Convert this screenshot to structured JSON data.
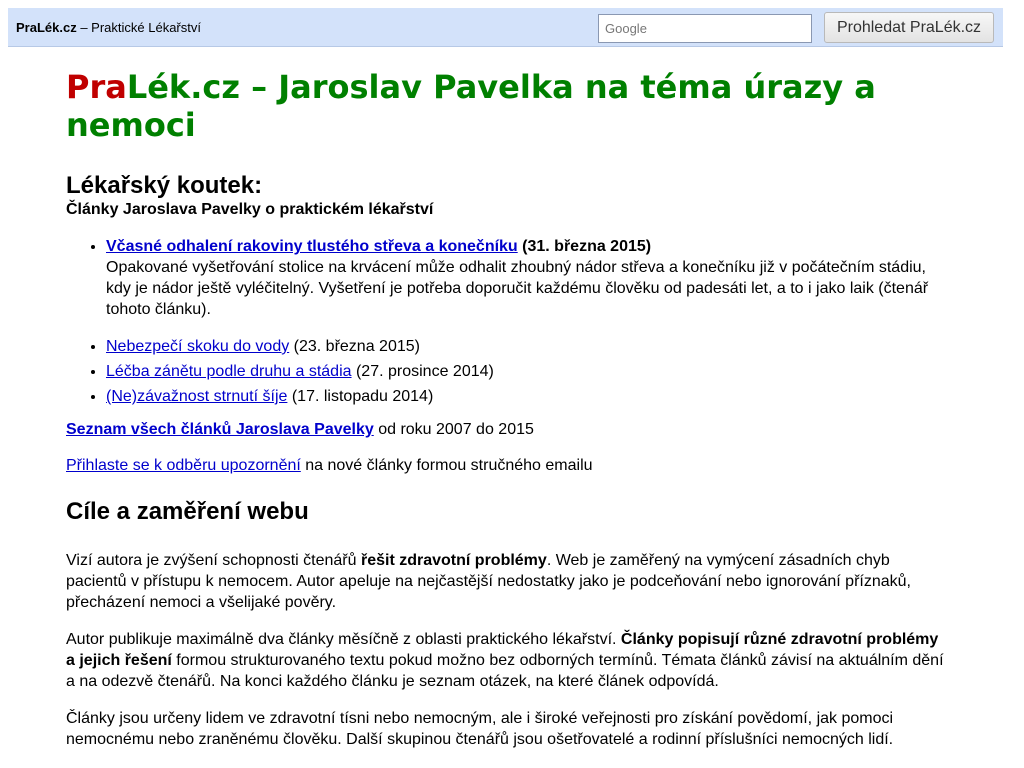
{
  "topbar": {
    "brand_name": "PraLék.cz",
    "brand_tagline": " – Praktické Lékařství",
    "search_placeholder": "Google",
    "search_button": "Prohledat PraLék.cz"
  },
  "header": {
    "title_pra": "Pra",
    "title_rest": "Lék.cz – Jaroslav Pavelka na téma úrazy a nemoci"
  },
  "koutek": {
    "title": "Lékařský koutek:",
    "subtitle": "Články Jaroslava Pavelky o praktickém lékařství"
  },
  "articles": [
    {
      "link": "Včasné odhalení rakoviny tlustého střeva a konečníku",
      "date": " (31. března 2015)",
      "desc": "Opakované vyšetřování stolice na krvácení může odhalit zhoubný nádor střeva a konečníku již v počátečním stádiu, kdy je nádor ještě vyléčitelný. Vyšetření je potřeba doporučit každému člověku od padesáti let, a to i jako laik (čtenář tohoto článku)."
    },
    {
      "link": "Nebezpečí skoku do vody",
      "date": " (23. března 2015)"
    },
    {
      "link": "Léčba zánětu podle druhu a stádia",
      "date": " (27. prosince 2014)"
    },
    {
      "link": "(Ne)závažnost strnutí šíje",
      "date": " (17. listopadu 2014)"
    }
  ],
  "all_articles": {
    "link": "Seznam všech článků Jaroslava Pavelky",
    "rest": " od roku 2007 do 2015"
  },
  "subscribe": {
    "link": "Přihlaste se k odběru upozornění",
    "rest": " na nové články formou stručného emailu"
  },
  "goals": {
    "heading": "Cíle a zaměření webu",
    "p1_a": "Vizí autora je zvýšení schopnosti čtenářů ",
    "p1_b": "řešit zdravotní problémy",
    "p1_c": ". Web je zaměřený na vymýcení zásadních chyb pacientů v přístupu k nemocem. Autor apeluje na nejčastější nedostatky jako je podceňování nebo ignorování příznaků, přecházení nemoci a všelijaké pověry.",
    "p2_a": "Autor publikuje maximálně dva články měsíčně z oblasti praktického lékařství. ",
    "p2_b": "Články popisují různé zdravotní problémy a jejich řešení",
    "p2_c": " formou strukturovaného textu pokud možno bez odborných termínů. Témata článků závisí na aktuálním dění a na odezvě čtenářů. Na konci každého článku je seznam otázek, na které článek odpovídá.",
    "p3": "Články jsou určeny lidem ve zdravotní tísni nebo nemocným, ale i široké veřejnosti pro získání povědomí, jak pomoci nemocnému nebo zraněnému člověku. Další skupinou čtenářů jsou ošetřovatelé a rodinní příslušníci nemocných lidí."
  }
}
